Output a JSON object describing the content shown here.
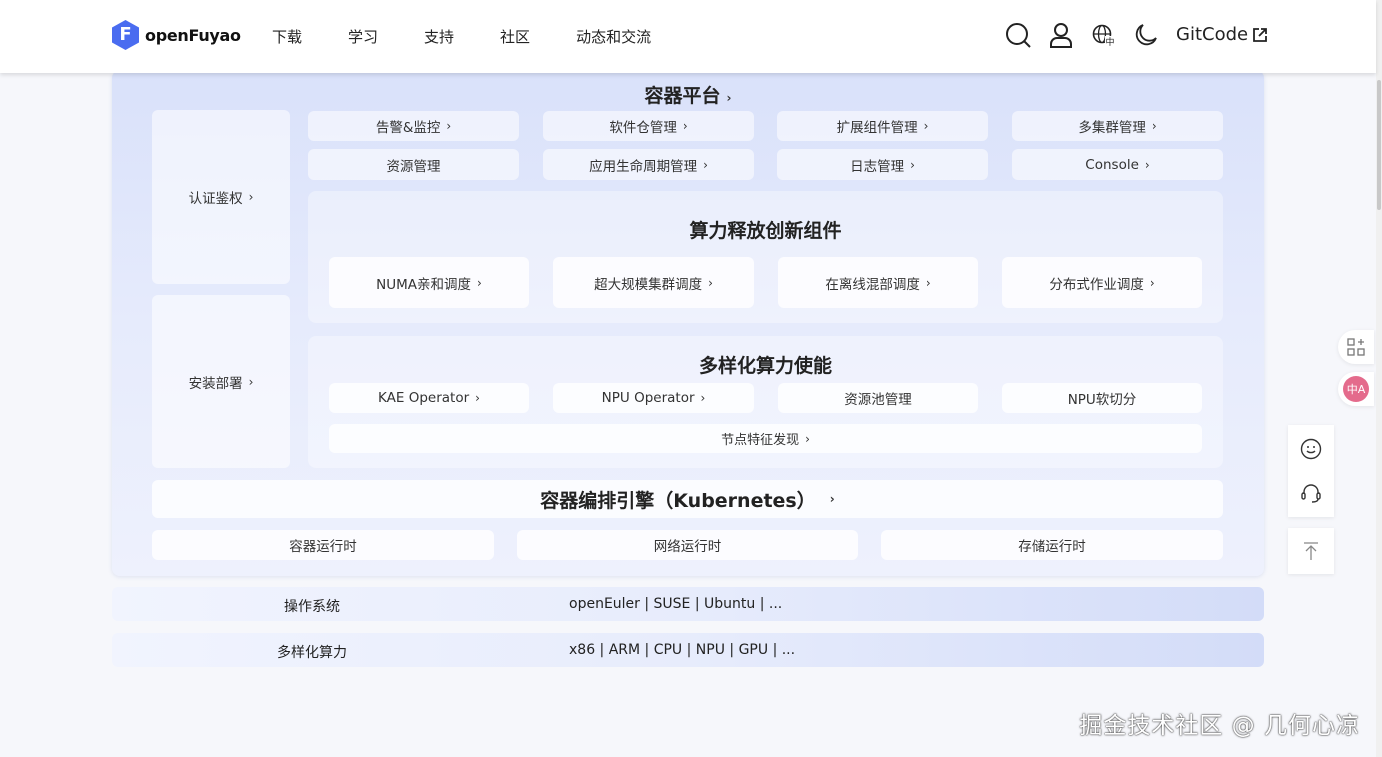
{
  "header": {
    "logo_text": "openFuyao",
    "nav": [
      "下载",
      "学习",
      "支持",
      "社区",
      "动态和交流"
    ],
    "gitcode": "GitCode"
  },
  "platform": {
    "title": "容器平台",
    "left": [
      "认证鉴权",
      "安装部署"
    ],
    "row1": [
      "告警&监控",
      "软件仓管理",
      "扩展组件管理",
      "多集群管理"
    ],
    "row2": [
      "资源管理",
      "应用生命周期管理",
      "日志管理",
      "Console"
    ],
    "innovation": {
      "title": "算力释放创新组件",
      "items": [
        "NUMA亲和调度",
        "超大规模集群调度",
        "在离线混部调度",
        "分布式作业调度"
      ]
    },
    "diverse": {
      "title": "多样化算力使能",
      "items": [
        "KAE Operator",
        "NPU Operator",
        "资源池管理",
        "NPU软切分"
      ],
      "wide": "节点特征发现"
    },
    "k8s": {
      "title": "容器编排引擎（Kubernetes）",
      "runtimes": [
        "容器运行时",
        "网络运行时",
        "存储运行时"
      ]
    }
  },
  "rows": [
    {
      "label": "操作系统",
      "value": "openEuler | SUSE | Ubuntu | ..."
    },
    {
      "label": "多样化算力",
      "value": "x86 | ARM | CPU | NPU | GPU | ..."
    }
  ],
  "watermark": "掘金技术社区 @ 几何心凉",
  "colors": {
    "brand": "#4a6cf0",
    "translate": "#e46b8c"
  }
}
